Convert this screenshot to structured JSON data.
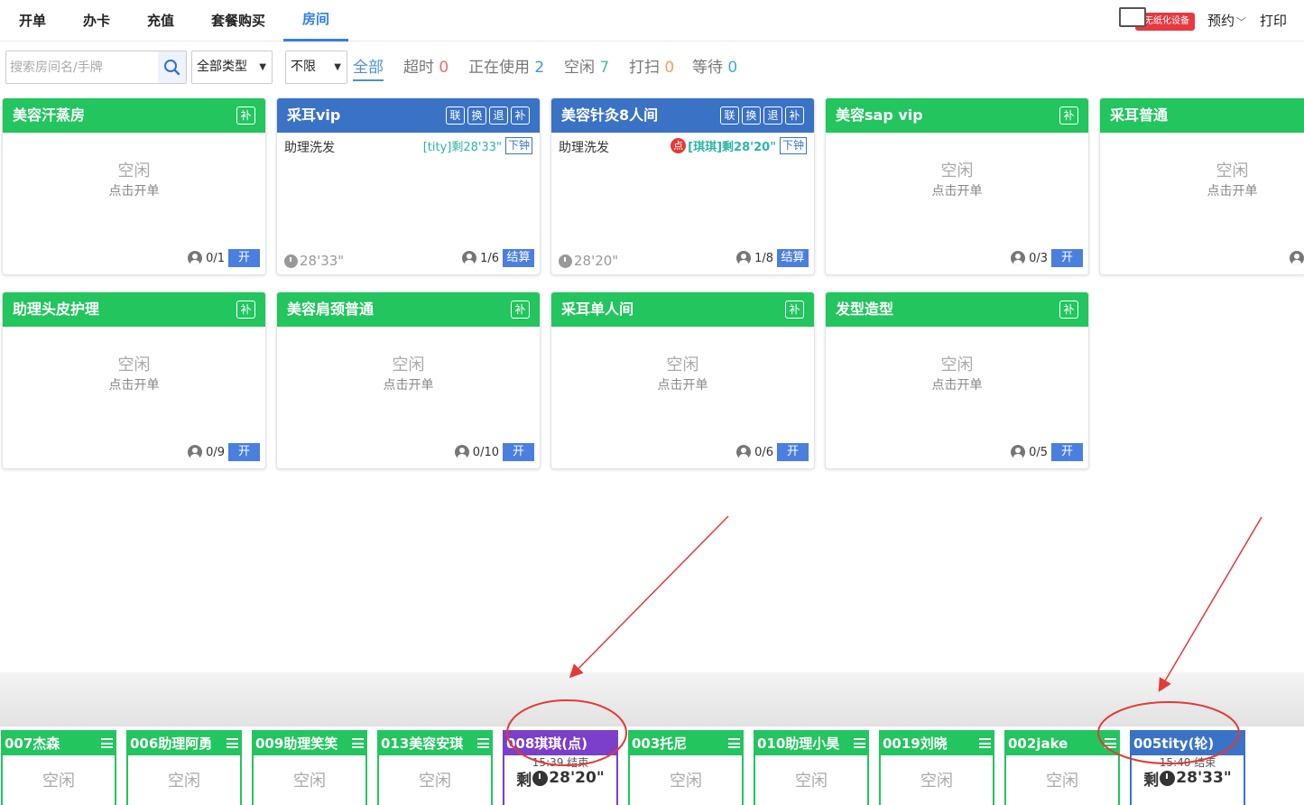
{
  "nav": {
    "tabs": [
      "开单",
      "办卡",
      "充值",
      "套餐购买",
      "房间"
    ],
    "device_badge": "无纸化设备",
    "reserve": "预约",
    "print": "打印"
  },
  "filters": {
    "search_placeholder": "搜索房间名/手牌",
    "type_select": "全部类型",
    "limit_select": "不限",
    "stats": [
      {
        "label": "全部",
        "count": ""
      },
      {
        "label": "超时",
        "count": "0"
      },
      {
        "label": "正在使用",
        "count": "2"
      },
      {
        "label": "空闲",
        "count": "7"
      },
      {
        "label": "打扫",
        "count": "0"
      },
      {
        "label": "等待",
        "count": "0"
      }
    ],
    "stat_colors": {
      "over": "#f06a6a",
      "using": "#4a90d9",
      "idle": "#3cc3a0",
      "clean": "#f5a25d",
      "wait": "#3bb0d8"
    }
  },
  "room_common": {
    "idle": "空闲",
    "click_open": "点击开单",
    "open_btn": "开",
    "settle_btn": "结算",
    "btn_link": "联",
    "btn_swap": "换",
    "btn_return": "退",
    "btn_add": "补",
    "down_clock": "下钟",
    "dot": "点"
  },
  "rooms": [
    {
      "name": "美容汗蒸房",
      "occupancy": "0/1"
    },
    {
      "name": "采耳vip",
      "occupancy": "1/6",
      "service": "助理洗发",
      "remain": "[tity]剩28'33\"",
      "elapsed": "28'33\""
    },
    {
      "name": "美容针灸8人间",
      "occupancy": "1/8",
      "service": "助理洗发",
      "remain": "[琪琪]剩28'20\"",
      "elapsed": "28'20\""
    },
    {
      "name": "美容sap vip",
      "occupancy": "0/3"
    },
    {
      "name": "采耳普通",
      "occupancy": ""
    },
    {
      "name": "助理头皮护理",
      "occupancy": "0/9"
    },
    {
      "name": "美容肩颈普通",
      "occupancy": "0/10"
    },
    {
      "name": "采耳单人间",
      "occupancy": "0/6"
    },
    {
      "name": "发型造型",
      "occupancy": "0/5"
    }
  ],
  "technicians": [
    {
      "name": "007杰森",
      "status": "空闲"
    },
    {
      "name": "006助理阿勇",
      "status": "空闲"
    },
    {
      "name": "009助理笑笑",
      "status": "空闲"
    },
    {
      "name": "013美容安琪",
      "status": "空闲"
    },
    {
      "name": "008琪琪(点)",
      "end": "15:39 结束",
      "remain_prefix": "剩",
      "remain": "28'20\""
    },
    {
      "name": "003托尼",
      "status": "空闲"
    },
    {
      "name": "010助理小昊",
      "status": "空闲"
    },
    {
      "name": "0019刘晓",
      "status": "空闲"
    },
    {
      "name": "002jake",
      "status": "空闲"
    },
    {
      "name": "005tity(轮)",
      "end": "15:40 结束",
      "remain_prefix": "剩",
      "remain": "28'33\""
    }
  ]
}
